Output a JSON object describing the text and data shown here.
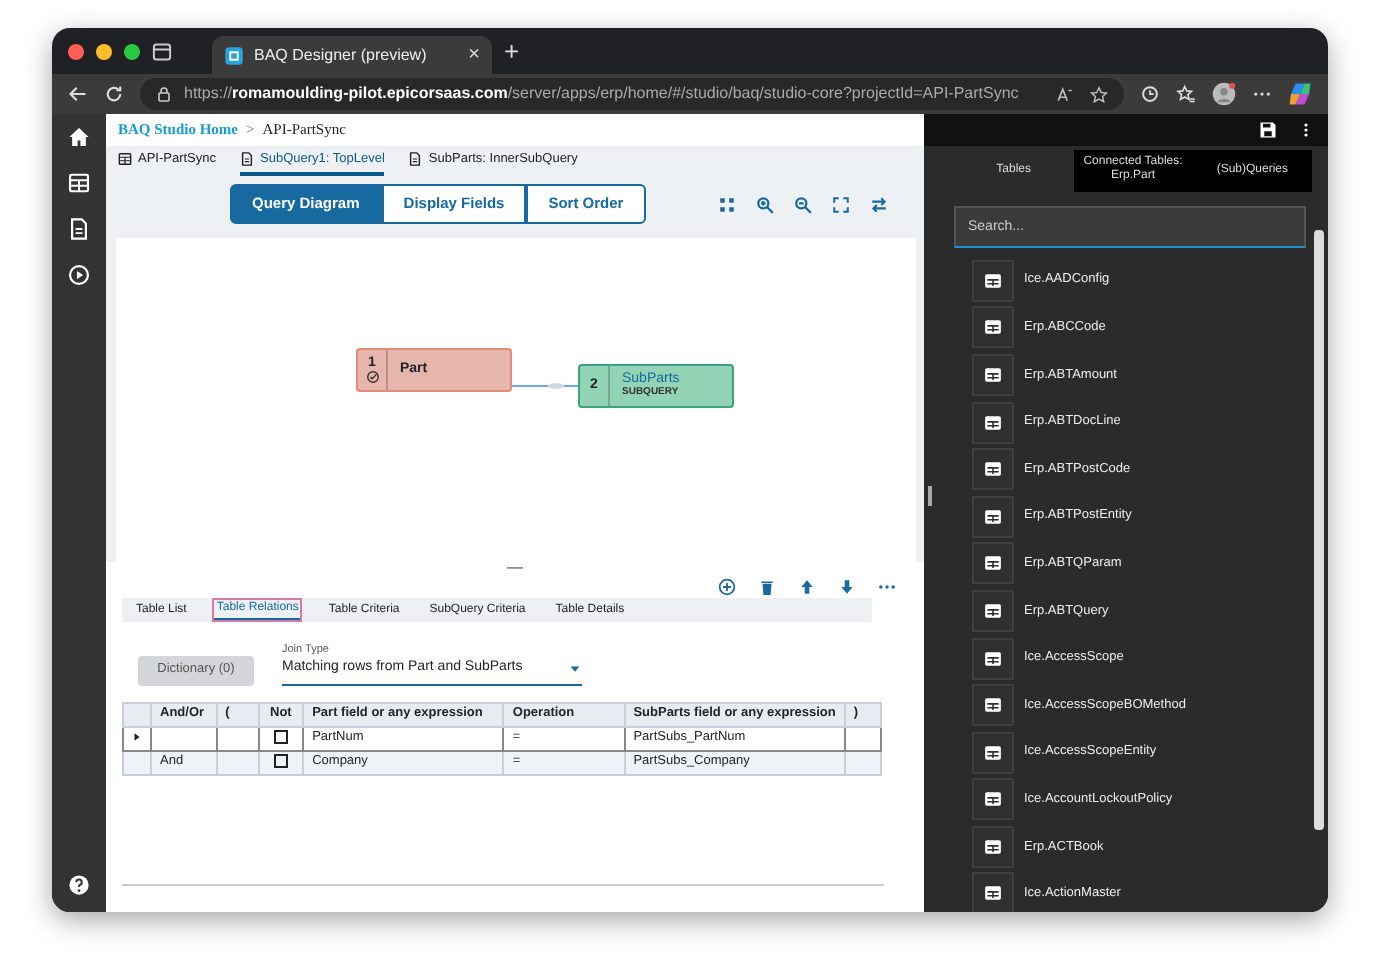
{
  "browser": {
    "tab_title": "BAQ Designer (preview)",
    "tab_close": "×",
    "new_tab": "+",
    "url": "https://**romamoulding-pilot.epicorsaas.com**/server/apps/erp/home/#/studio/baq/studio-core?projectId=API-PartSync"
  },
  "breadcrumb": [
    {
      "label": "BAQ Studio Home",
      "kind": "link"
    },
    {
      "label": ">",
      "kind": "separator"
    },
    {
      "label": "API-PartSync",
      "kind": "current"
    }
  ],
  "query_tabs": [
    {
      "label": "API-PartSync",
      "kind": "project",
      "selected": false
    },
    {
      "label": "SubQuery1: TopLevel",
      "kind": "subquery",
      "selected": true
    },
    {
      "label": "SubParts: InnerSubQuery",
      "kind": "subquery",
      "selected": false
    }
  ],
  "view_buttons": [
    {
      "label": "Query Diagram",
      "selected": true
    },
    {
      "label": "Display Fields",
      "selected": false
    },
    {
      "label": "Sort Order",
      "selected": false
    }
  ],
  "diagram": {
    "nodes": [
      {
        "number": "1",
        "name": "Part",
        "kind": "table"
      },
      {
        "number": "2",
        "name": "SubParts",
        "kind": "subquery",
        "subtitle": "SUBQUERY"
      }
    ]
  },
  "splitter": "—",
  "bottom_tabs": [
    {
      "label": "Table List",
      "selected": false
    },
    {
      "label": "Table Relations",
      "selected": true
    },
    {
      "label": "Table Criteria",
      "selected": false
    },
    {
      "label": "SubQuery Criteria",
      "selected": false
    },
    {
      "label": "Table Details",
      "selected": false
    }
  ],
  "dictionary_button": {
    "label": "Dictionary (0)",
    "disabled": true
  },
  "join_type": {
    "label": "Join Type",
    "value": "Matching rows from Part and SubParts"
  },
  "relations_table": {
    "columns": [
      "And/Or",
      "(",
      "Not",
      "Part field or any expression",
      "Operation",
      "SubParts field or any expression",
      ")"
    ],
    "rows": [
      {
        "selected": true,
        "not": false,
        "part_field": "PartNum",
        "operation": "=",
        "subparts_field": "PartSubs_PartNum"
      },
      {
        "selected": false,
        "and_or": "And",
        "not": false,
        "part_field": "Company",
        "operation": "=",
        "subparts_field": "PartSubs_Company"
      }
    ]
  },
  "right_panel": {
    "tabs": [
      {
        "label": "Tables",
        "selected": true
      },
      {
        "label": "Connected Tables: Erp.Part",
        "selected": false
      },
      {
        "label": "(Sub)Queries",
        "selected": false
      }
    ],
    "search": {
      "placeholder": "Search..."
    },
    "tables": [
      "Ice.AADConfig",
      "Erp.ABCCode",
      "Erp.ABTAmount",
      "Erp.ABTDocLine",
      "Erp.ABTPostCode",
      "Erp.ABTPostEntity",
      "Erp.ABTQParam",
      "Erp.ABTQuery",
      "Ice.AccessScope",
      "Ice.AccessScopeBOMethod",
      "Ice.AccessScopeEntity",
      "Ice.AccountLockoutPolicy",
      "Erp.ACTBook",
      "Ice.ActionMaster"
    ]
  }
}
